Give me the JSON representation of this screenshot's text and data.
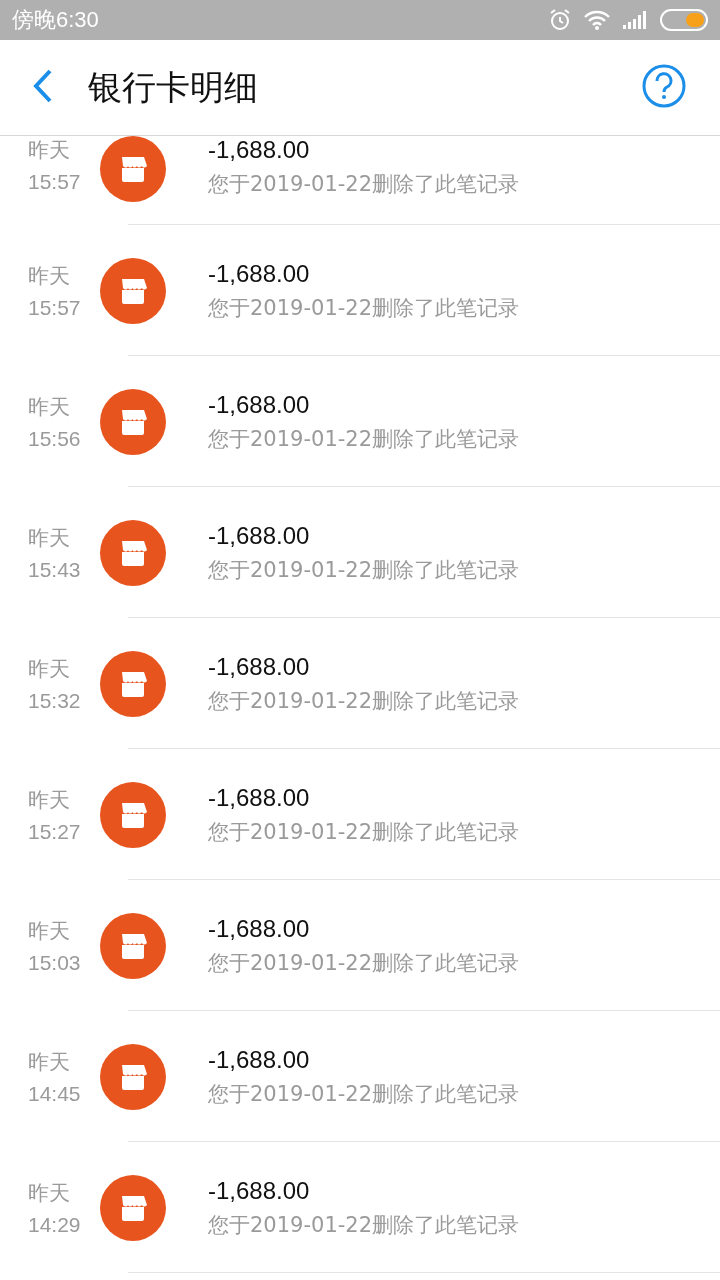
{
  "status_bar": {
    "time": "傍晚6:30"
  },
  "header": {
    "title": "银行卡明细"
  },
  "transactions": [
    {
      "day": "昨天",
      "time": "15:57",
      "amount": "-1,688.00",
      "note": "您于2019-01-22删除了此笔记录"
    },
    {
      "day": "昨天",
      "time": "15:57",
      "amount": "-1,688.00",
      "note": "您于2019-01-22删除了此笔记录"
    },
    {
      "day": "昨天",
      "time": "15:56",
      "amount": "-1,688.00",
      "note": "您于2019-01-22删除了此笔记录"
    },
    {
      "day": "昨天",
      "time": "15:43",
      "amount": "-1,688.00",
      "note": "您于2019-01-22删除了此笔记录"
    },
    {
      "day": "昨天",
      "time": "15:32",
      "amount": "-1,688.00",
      "note": "您于2019-01-22删除了此笔记录"
    },
    {
      "day": "昨天",
      "time": "15:27",
      "amount": "-1,688.00",
      "note": "您于2019-01-22删除了此笔记录"
    },
    {
      "day": "昨天",
      "time": "15:03",
      "amount": "-1,688.00",
      "note": "您于2019-01-22删除了此笔记录"
    },
    {
      "day": "昨天",
      "time": "14:45",
      "amount": "-1,688.00",
      "note": "您于2019-01-22删除了此笔记录"
    },
    {
      "day": "昨天",
      "time": "14:29",
      "amount": "-1,688.00",
      "note": "您于2019-01-22删除了此笔记录"
    }
  ]
}
